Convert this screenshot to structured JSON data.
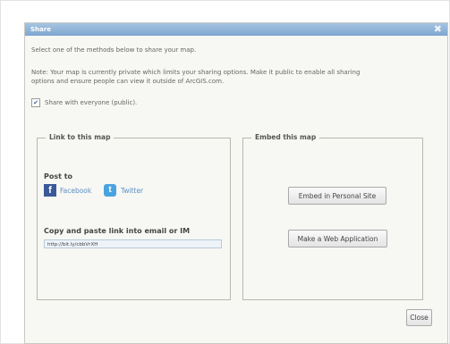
{
  "dialog": {
    "title": "Share",
    "close_glyph": "✖",
    "intro": "Select one of the methods below to share your map.",
    "note_line1": "Note: Your map is currently private which limits your sharing options. Make it public to enable all sharing",
    "note_line2": "options and ensure people can view it outside of ArcGIS.com.",
    "share_checkbox": {
      "checked": true,
      "label": "Share with everyone (public)."
    },
    "link_section": {
      "legend": "Link to this map",
      "post_to": "Post to",
      "facebook": {
        "icon": "facebook-icon",
        "glyph": "f",
        "label": "Facebook"
      },
      "twitter": {
        "icon": "twitter-icon",
        "glyph": "t",
        "label": "Twitter"
      },
      "copy_label": "Copy and paste link into email or IM",
      "link_value": "http://bit.ly/cbbVrXH"
    },
    "embed_section": {
      "legend": "Embed this map",
      "embed_button": "Embed in Personal Site",
      "webapp_button": "Make a Web Application"
    },
    "close_button": "Close"
  },
  "colors": {
    "titlebar": "#8fb3d6",
    "facebook": "#3b5998",
    "twitter": "#4aa3e0",
    "link": "#5b8ec5"
  }
}
